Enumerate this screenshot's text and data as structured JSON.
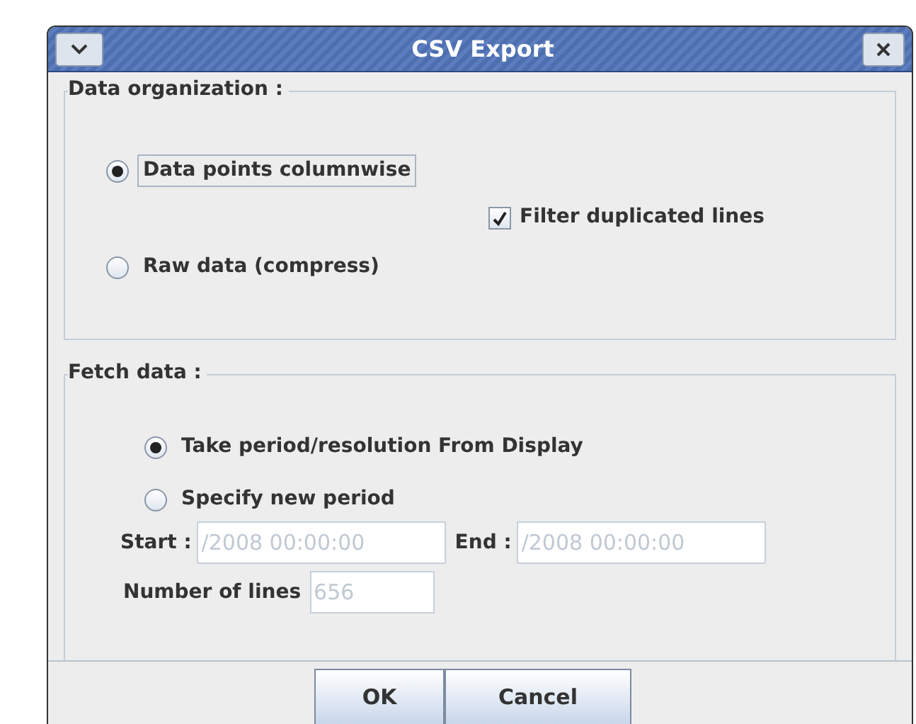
{
  "window": {
    "title": "CSV Export"
  },
  "data_organization": {
    "title": "Data organization :",
    "options": [
      {
        "label": "Data points columnwise",
        "selected": true
      },
      {
        "label": "Raw data (compress)",
        "selected": false
      }
    ],
    "filter": {
      "label": "Filter duplicated lines",
      "checked": true
    }
  },
  "fetch_data": {
    "title": "Fetch data :",
    "options": [
      {
        "label": "Take period/resolution From Display",
        "selected": true
      },
      {
        "label": "Specify new period",
        "selected": false
      }
    ],
    "start": {
      "label": "Start :",
      "value": "/2008 00:00:00"
    },
    "end": {
      "label": "End :",
      "value": "/2008 00:00:00"
    },
    "lines": {
      "label": "Number of lines",
      "value": "656"
    }
  },
  "buttons": [
    "OK",
    "Cancel"
  ]
}
